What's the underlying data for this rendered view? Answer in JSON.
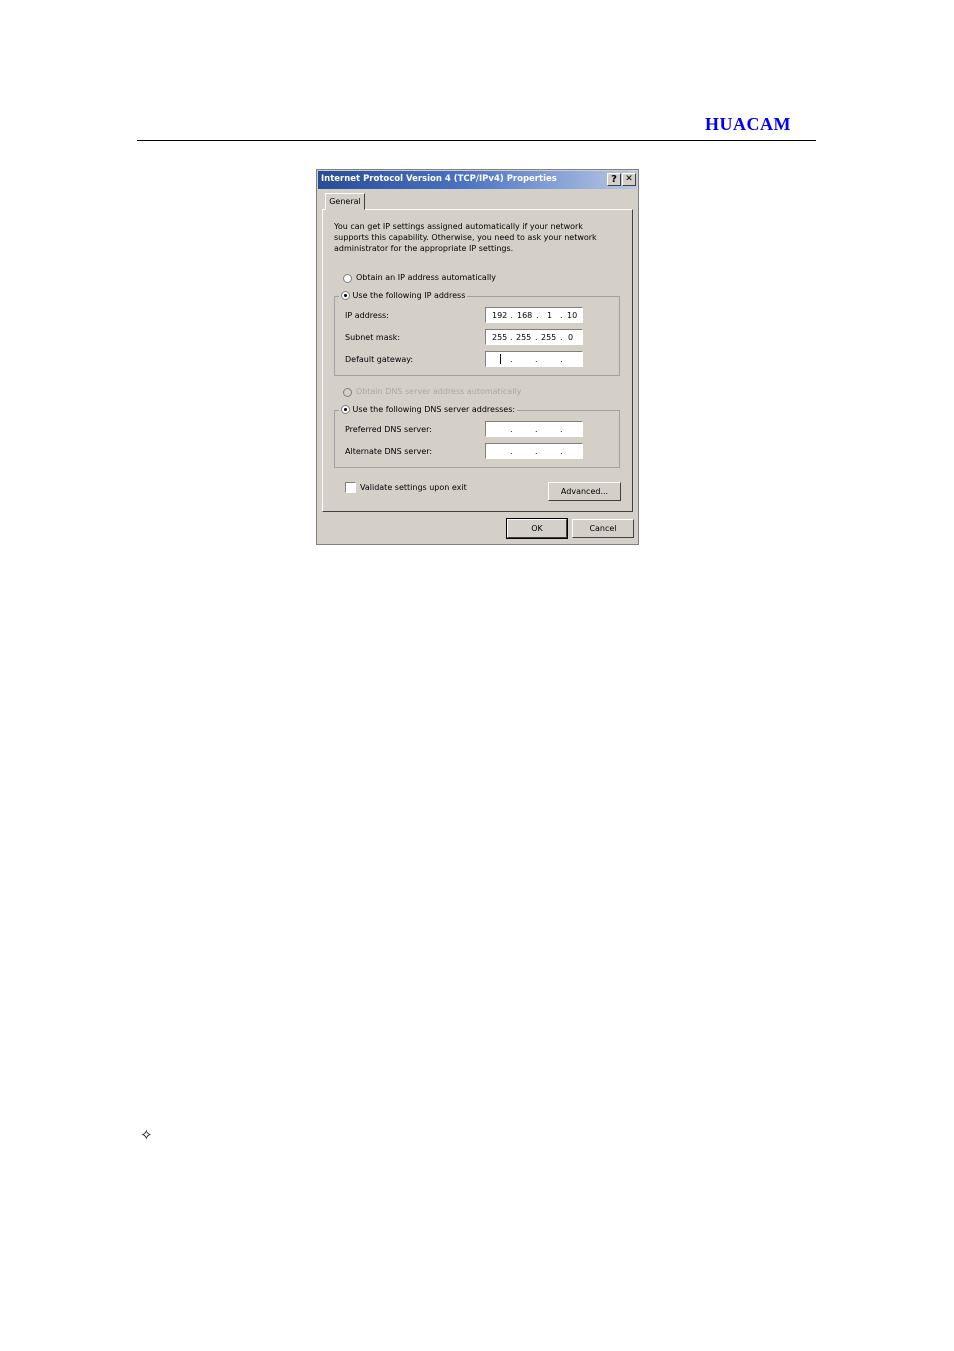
{
  "header": {
    "brand": "HUACAM"
  },
  "footer": {
    "bullet": "✧"
  },
  "dialog": {
    "title": "Internet Protocol Version 4 (TCP/IPv4) Properties",
    "help_button": "?",
    "close_button": "✕",
    "tab": "General",
    "description": "You can get IP settings assigned automatically if your network supports this capability. Otherwise, you need to ask your network administrator for the appropriate IP settings.",
    "obtain_ip_auto": "Obtain an IP address automatically",
    "use_ip": "Use the following IP address",
    "ip_label": "IP address:",
    "ip_value": [
      "192",
      "168",
      "1",
      "10"
    ],
    "subnet_label": "Subnet mask:",
    "subnet_value": [
      "255",
      "255",
      "255",
      "0"
    ],
    "gateway_label": "Default gateway:",
    "obtain_dns_auto": "Obtain DNS server address automatically",
    "use_dns": "Use the following DNS server addresses:",
    "preferred_dns_label": "Preferred DNS server:",
    "alternate_dns_label": "Alternate DNS server:",
    "validate_label": "Validate settings upon exit",
    "advanced_button": "Advanced...",
    "ok_button": "OK",
    "cancel_button": "Cancel",
    "dot": "."
  }
}
